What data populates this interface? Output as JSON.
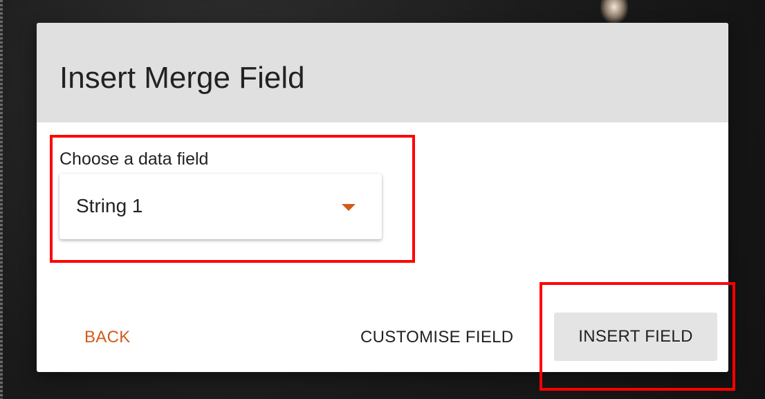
{
  "dialog": {
    "title": "Insert Merge Field",
    "field_label": "Choose a data field",
    "select": {
      "value": "String 1",
      "icon": "caret-down-icon"
    },
    "buttons": {
      "back": "BACK",
      "customise": "CUSTOMISE FIELD",
      "insert": "INSERT FIELD"
    }
  },
  "colors": {
    "accent": "#d35a1a",
    "header_bg": "#e0e0e0",
    "highlight": "#ff0000"
  }
}
